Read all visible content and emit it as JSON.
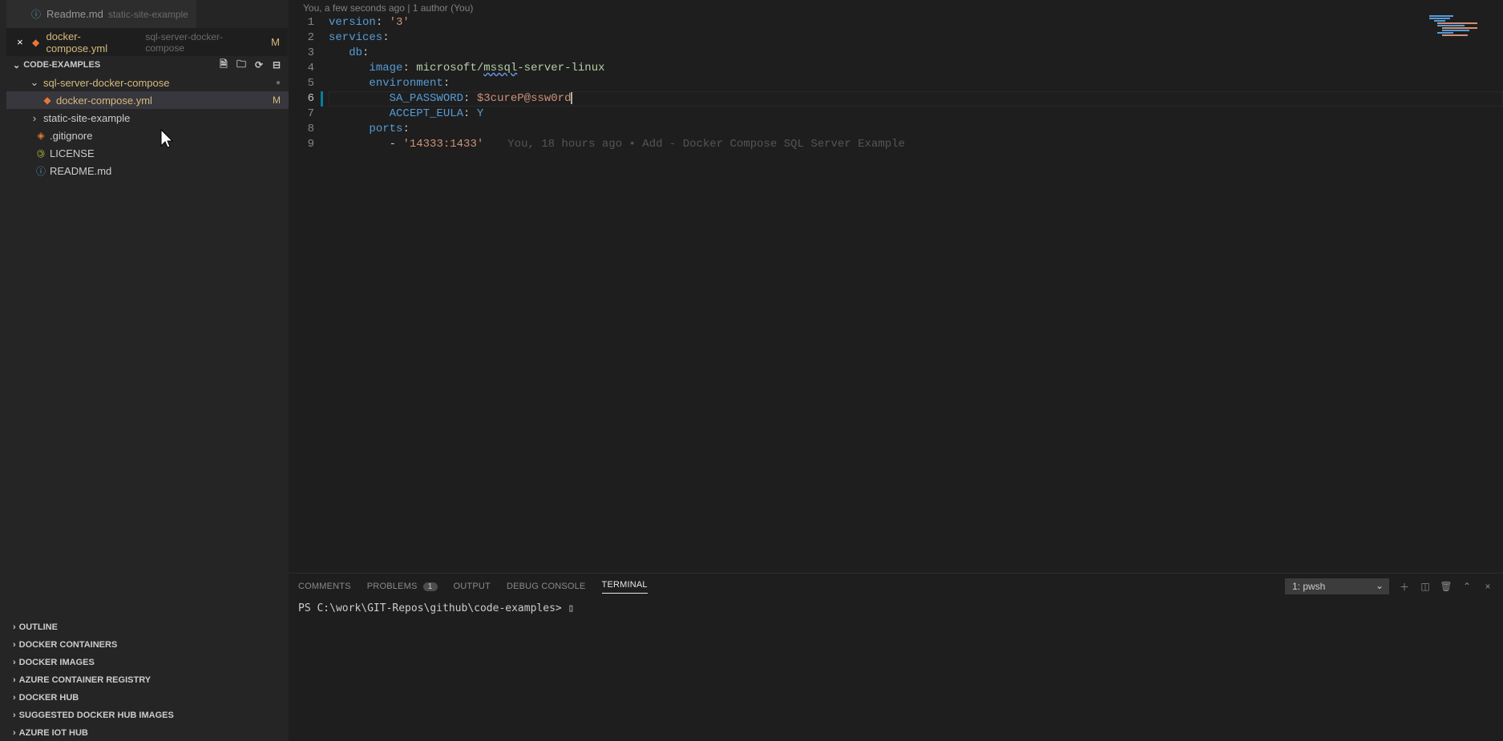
{
  "openTabs": [
    {
      "name": "Readme.md",
      "desc": "static-site-example",
      "icon": "info",
      "active": false
    },
    {
      "name": "docker-compose.yml",
      "desc": "sql-server-docker-compose",
      "icon": "docker",
      "active": true,
      "badge": "M"
    }
  ],
  "explorer": {
    "section": "CODE-EXAMPLES",
    "tree": [
      {
        "type": "folder",
        "name": "sql-server-docker-compose",
        "open": true,
        "modified": true,
        "level": 1
      },
      {
        "type": "file",
        "name": "docker-compose.yml",
        "icon": "docker",
        "modified": true,
        "badge": "M",
        "selected": true,
        "level": 2
      },
      {
        "type": "folder",
        "name": "static-site-example",
        "open": false,
        "level": 1
      },
      {
        "type": "file",
        "name": ".gitignore",
        "icon": "git",
        "level": 1
      },
      {
        "type": "file",
        "name": "LICENSE",
        "icon": "license",
        "level": 1
      },
      {
        "type": "file",
        "name": "README.md",
        "icon": "info",
        "level": 1
      }
    ]
  },
  "collapsedSections": [
    "OUTLINE",
    "DOCKER CONTAINERS",
    "DOCKER IMAGES",
    "AZURE CONTAINER REGISTRY",
    "DOCKER HUB",
    "SUGGESTED DOCKER HUB IMAGES",
    "AZURE IOT HUB"
  ],
  "editor": {
    "topBlame": "You, a few seconds ago | 1 author (You)",
    "lines": [
      {
        "n": 1,
        "tokens": [
          [
            "key",
            "version"
          ],
          [
            "punct",
            ":"
          ],
          [
            "punct",
            " "
          ],
          [
            "str",
            "'3'"
          ]
        ]
      },
      {
        "n": 2,
        "tokens": [
          [
            "key",
            "services"
          ],
          [
            "punct",
            ":"
          ]
        ]
      },
      {
        "n": 3,
        "indent": 1,
        "tokens": [
          [
            "key",
            "db"
          ],
          [
            "punct",
            ":"
          ]
        ]
      },
      {
        "n": 4,
        "indent": 2,
        "tokens": [
          [
            "key",
            "image"
          ],
          [
            "punct",
            ":"
          ],
          [
            "punct",
            " "
          ],
          [
            "val",
            "microsoft/"
          ],
          [
            "squiggle",
            "mssql"
          ],
          [
            "val",
            "-server-linux"
          ]
        ]
      },
      {
        "n": 5,
        "indent": 2,
        "tokens": [
          [
            "key",
            "environment"
          ],
          [
            "punct",
            ":"
          ]
        ]
      },
      {
        "n": 6,
        "indent": 3,
        "active": true,
        "modMark": true,
        "tokens": [
          [
            "key",
            "SA_PASSWORD"
          ],
          [
            "punct",
            ":"
          ],
          [
            "punct",
            " "
          ],
          [
            "str",
            "$3cureP@ssw0rd"
          ]
        ]
      },
      {
        "n": 7,
        "indent": 3,
        "tokens": [
          [
            "key",
            "ACCEPT_EULA"
          ],
          [
            "punct",
            ":"
          ],
          [
            "punct",
            " "
          ],
          [
            "const",
            "Y"
          ]
        ]
      },
      {
        "n": 8,
        "indent": 2,
        "tokens": [
          [
            "key",
            "ports"
          ],
          [
            "punct",
            ":"
          ]
        ]
      },
      {
        "n": 9,
        "indent": 3,
        "tokens": [
          [
            "punct",
            "- "
          ],
          [
            "str",
            "'14333:1433'"
          ]
        ],
        "blame": "You, 18 hours ago • Add - Docker Compose SQL Server Example"
      }
    ]
  },
  "panel": {
    "tabs": [
      {
        "label": "COMMENTS"
      },
      {
        "label": "PROBLEMS",
        "count": "1"
      },
      {
        "label": "OUTPUT"
      },
      {
        "label": "DEBUG CONSOLE"
      },
      {
        "label": "TERMINAL",
        "active": true
      }
    ],
    "terminalSelect": "1: pwsh",
    "terminalLine": "PS C:\\work\\GIT-Repos\\github\\code-examples> "
  }
}
